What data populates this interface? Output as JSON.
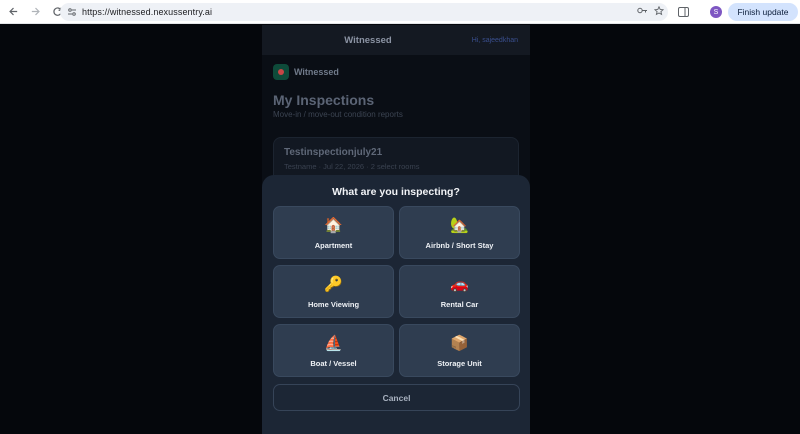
{
  "browser": {
    "url": "https://witnessed.nexussentry.ai",
    "finish_update": "Finish update",
    "profile_initial": "S"
  },
  "app": {
    "header_title": "Witnessed",
    "greeting": "Hi, sajeedkhan",
    "brand_name": "Witnessed",
    "page_title": "My Inspections",
    "page_subtitle": "Move-in / move-out condition reports",
    "inspection": {
      "name": "Testinspectionjuly21",
      "meta": "Testname · Jul 22, 2026 · 2 select rooms"
    }
  },
  "modal": {
    "title": "What are you inspecting?",
    "options": [
      {
        "emoji": "🏠",
        "label": "Apartment"
      },
      {
        "emoji": "🏡",
        "label": "Airbnb / Short Stay"
      },
      {
        "emoji": "🔑",
        "label": "Home Viewing"
      },
      {
        "emoji": "🚗",
        "label": "Rental Car"
      },
      {
        "emoji": "⛵",
        "label": "Boat / Vessel"
      },
      {
        "emoji": "📦",
        "label": "Storage Unit"
      }
    ],
    "cancel_label": "Cancel"
  },
  "colors": {
    "sheet_bg": "#1c2635",
    "option_bg": "#2f3d50",
    "page_bg": "#05070c"
  }
}
